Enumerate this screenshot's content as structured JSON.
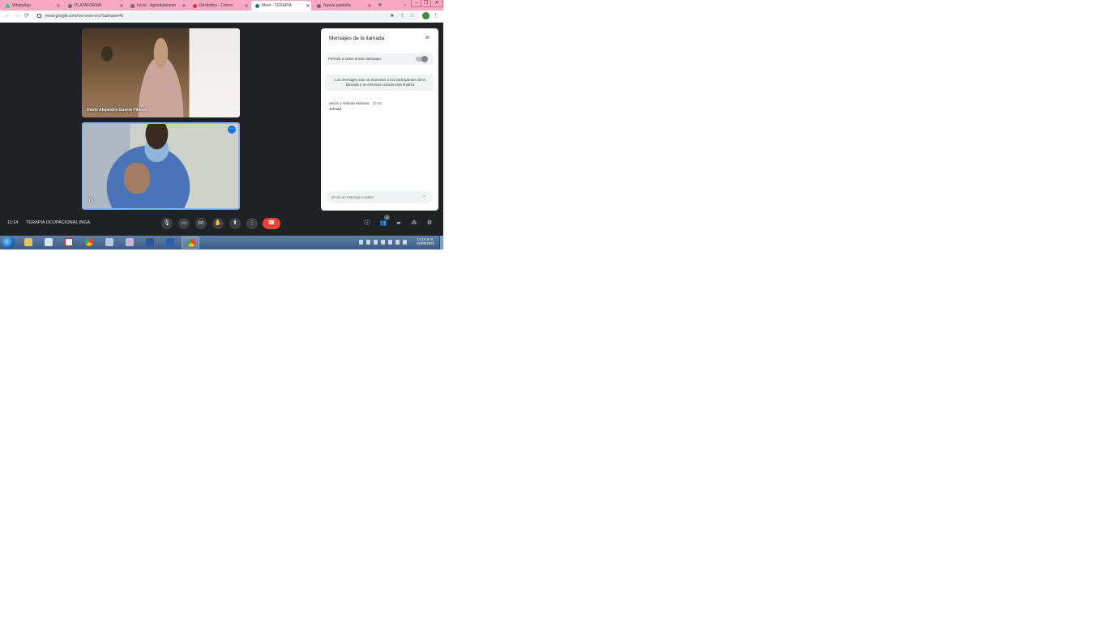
{
  "browser": {
    "tabs": [
      {
        "label": "WhatsApp",
        "active": false
      },
      {
        "label": "PLATAFORMA",
        "active": false
      },
      {
        "label": "Inicio - Agendamiento",
        "active": false
      },
      {
        "label": "Recibidos - Correo",
        "active": false
      },
      {
        "label": "Meet - TERAPIA",
        "active": true
      },
      {
        "label": "Nueva pestaña",
        "active": false
      }
    ],
    "new_tab": "+",
    "url": "meet.google.com/xxx-xxxx-xxx?authuser=0",
    "icons": {
      "back": "arrow-left-icon",
      "forward": "arrow-right-icon",
      "reload": "reload-icon",
      "lock": "lock-icon",
      "star": "star-icon",
      "menu": "kebab-icon"
    }
  },
  "meet": {
    "tiles": [
      {
        "name": "Dante Alejandro Guerra Pilares"
      },
      {
        "name": "Tú"
      }
    ],
    "chat": {
      "title": "Mensajes de la llamada",
      "toggle_label": "Permitir a todos enviar mensajes",
      "toggle_on": false,
      "info": "Los mensajes solo se muestran a los participantes de la llamada y se eliminan cuando esta finaliza",
      "messages": [
        {
          "sender": "Serón y Velarde Mariana",
          "time": "10:44",
          "text": "Jormad"
        }
      ],
      "input_placeholder": "Envía un mensaje a todos"
    },
    "bar": {
      "time": "11:14",
      "meeting_name": "TERAPIA OCUPACIONAL INGA",
      "participant_count": "2"
    }
  },
  "taskbar": {
    "time": "11:14 a.m.",
    "date": "29/09/2022"
  },
  "colors": {
    "tab_strip": "#f8a8c3",
    "meet_background": "#202124",
    "end_call": "#ea4335",
    "accent": "#8ab4f8"
  }
}
